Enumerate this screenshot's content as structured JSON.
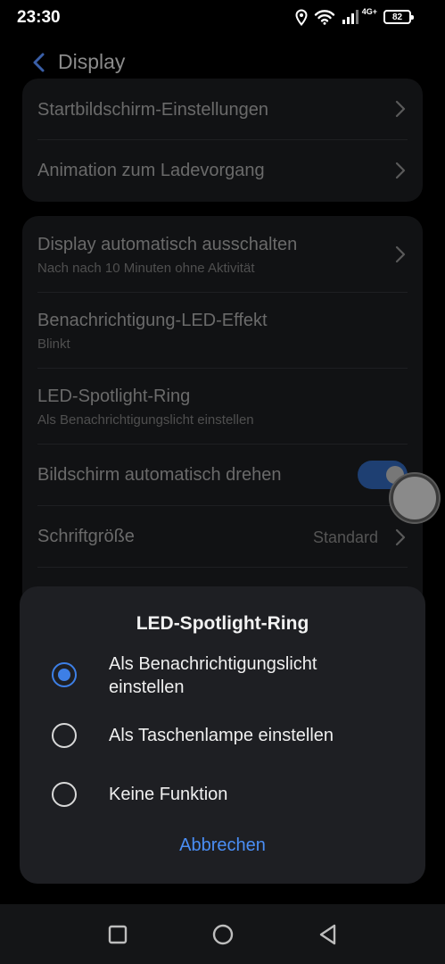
{
  "status_bar": {
    "time": "23:30",
    "network_type": "4G+",
    "battery": "82",
    "icons": [
      "location-icon",
      "wifi-icon",
      "signal-icon",
      "battery-icon"
    ]
  },
  "header": {
    "title": "Display",
    "back_icon": "chevron-left-icon"
  },
  "card1": {
    "items": [
      {
        "title": "Startbildschirm-Einstellungen"
      },
      {
        "title": "Animation zum Ladevorgang"
      }
    ]
  },
  "card2": {
    "items": [
      {
        "title": "Display automatisch ausschalten",
        "subtitle": "Nach nach 10 Minuten ohne Aktivität"
      },
      {
        "title": "Benachrichtigung-LED-Effekt",
        "subtitle": "Blinkt"
      },
      {
        "title": "LED-Spotlight-Ring",
        "subtitle": "Als Benachrichtigungslicht einstellen"
      },
      {
        "title": "Bildschirm automatisch drehen",
        "toggle_on": true
      },
      {
        "title": "Schriftgröße",
        "value": "Standard"
      }
    ]
  },
  "dialog": {
    "title": "LED-Spotlight-Ring",
    "options": [
      {
        "label": "Als Benachrichtigungslicht einstellen",
        "selected": true
      },
      {
        "label": "Als Taschenlampe einstellen",
        "selected": false
      },
      {
        "label": "Keine Funktion",
        "selected": false
      }
    ],
    "cancel_label": "Abbrechen"
  },
  "nav_bar": {
    "buttons": [
      "recents-square-icon",
      "home-circle-icon",
      "back-triangle-icon"
    ]
  },
  "colors": {
    "accent": "#3d7fe6",
    "link": "#4a8ef5",
    "dialog_bg": "#1e1f23",
    "card_bg": "#111214"
  }
}
